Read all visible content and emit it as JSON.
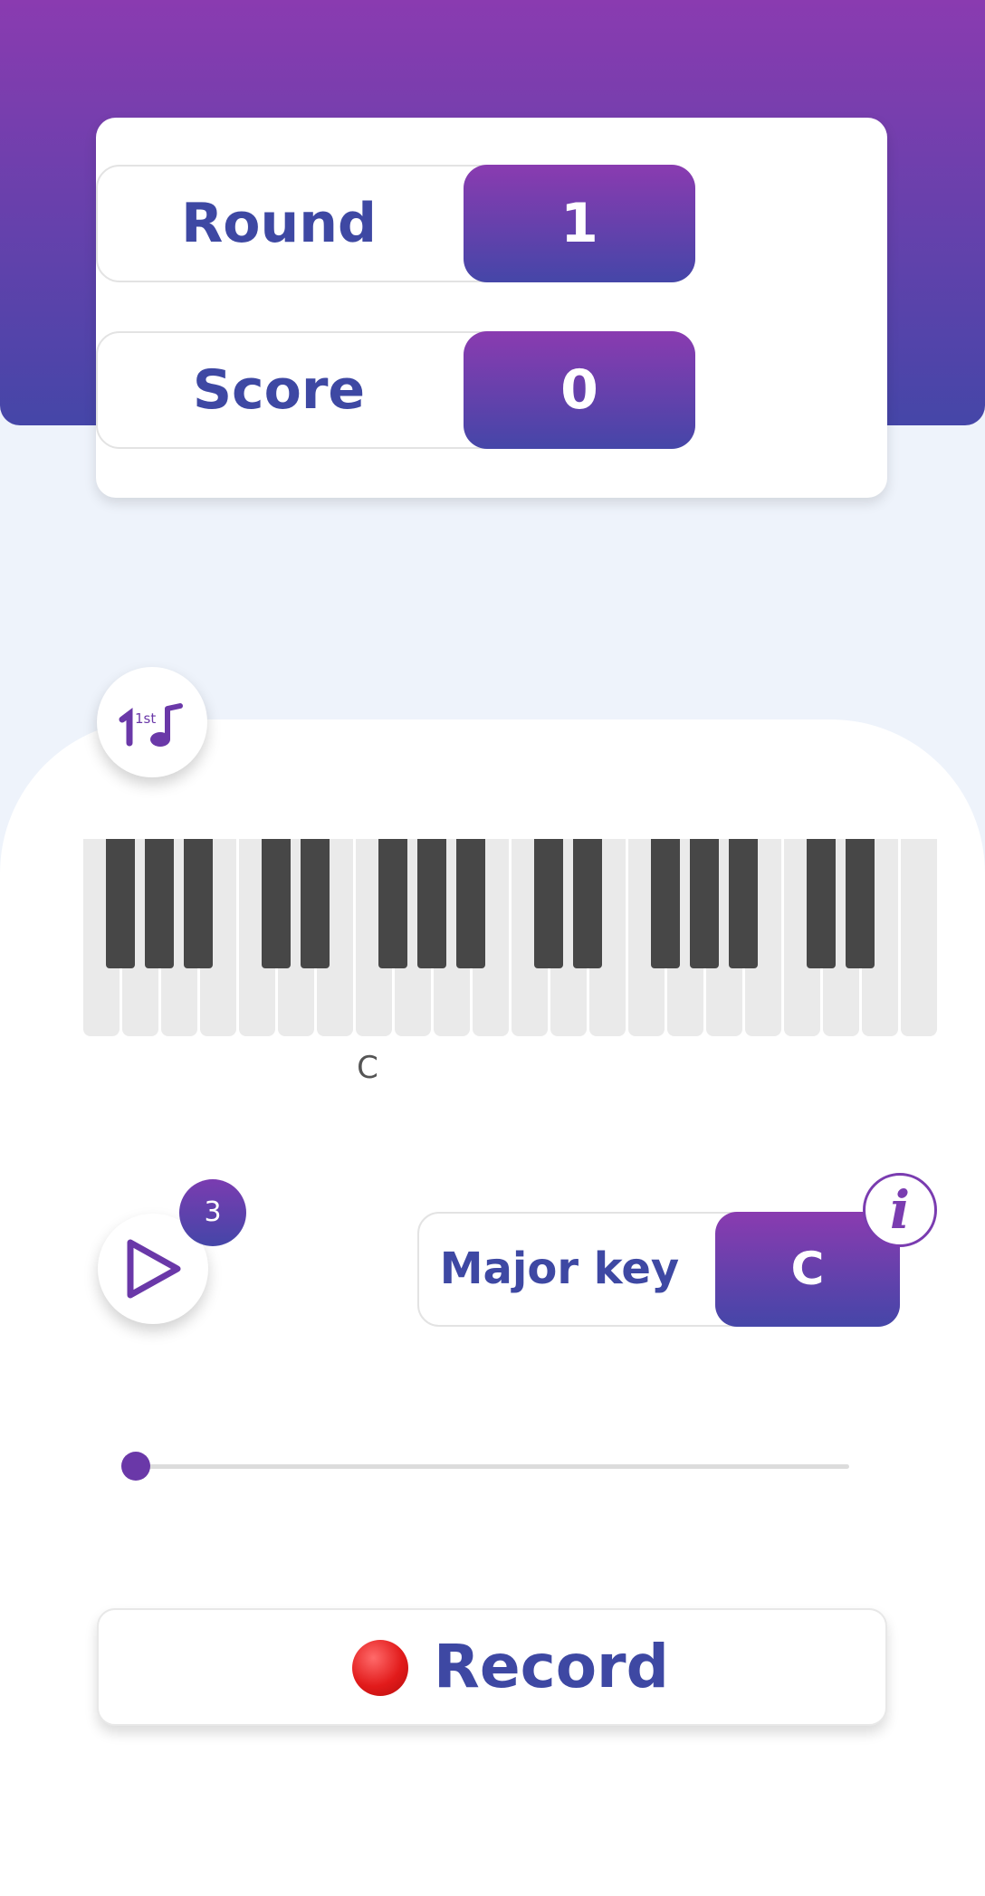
{
  "stats": {
    "round_label": "Round",
    "round_value": "1",
    "score_label": "Score",
    "score_value": "0"
  },
  "mode_button": {
    "icon": "first-note-music-icon",
    "text": "1st"
  },
  "piano": {
    "white_key_count": 22,
    "highlighted_key": "C",
    "note_label": "C"
  },
  "play": {
    "icon": "play-icon",
    "badge_count": "3"
  },
  "key_selector": {
    "label": "Major key",
    "value": "C"
  },
  "info": {
    "icon": "info-icon",
    "glyph": "i"
  },
  "progress": {
    "value": 0
  },
  "record": {
    "label": "Record",
    "icon": "record-dot-icon"
  },
  "colors": {
    "gradient_top": "#8a3bb0",
    "gradient_bottom": "#4546a8",
    "accent_text": "#3e48a3",
    "active_key": "#7b86e4",
    "record_red": "#e21b1b"
  }
}
